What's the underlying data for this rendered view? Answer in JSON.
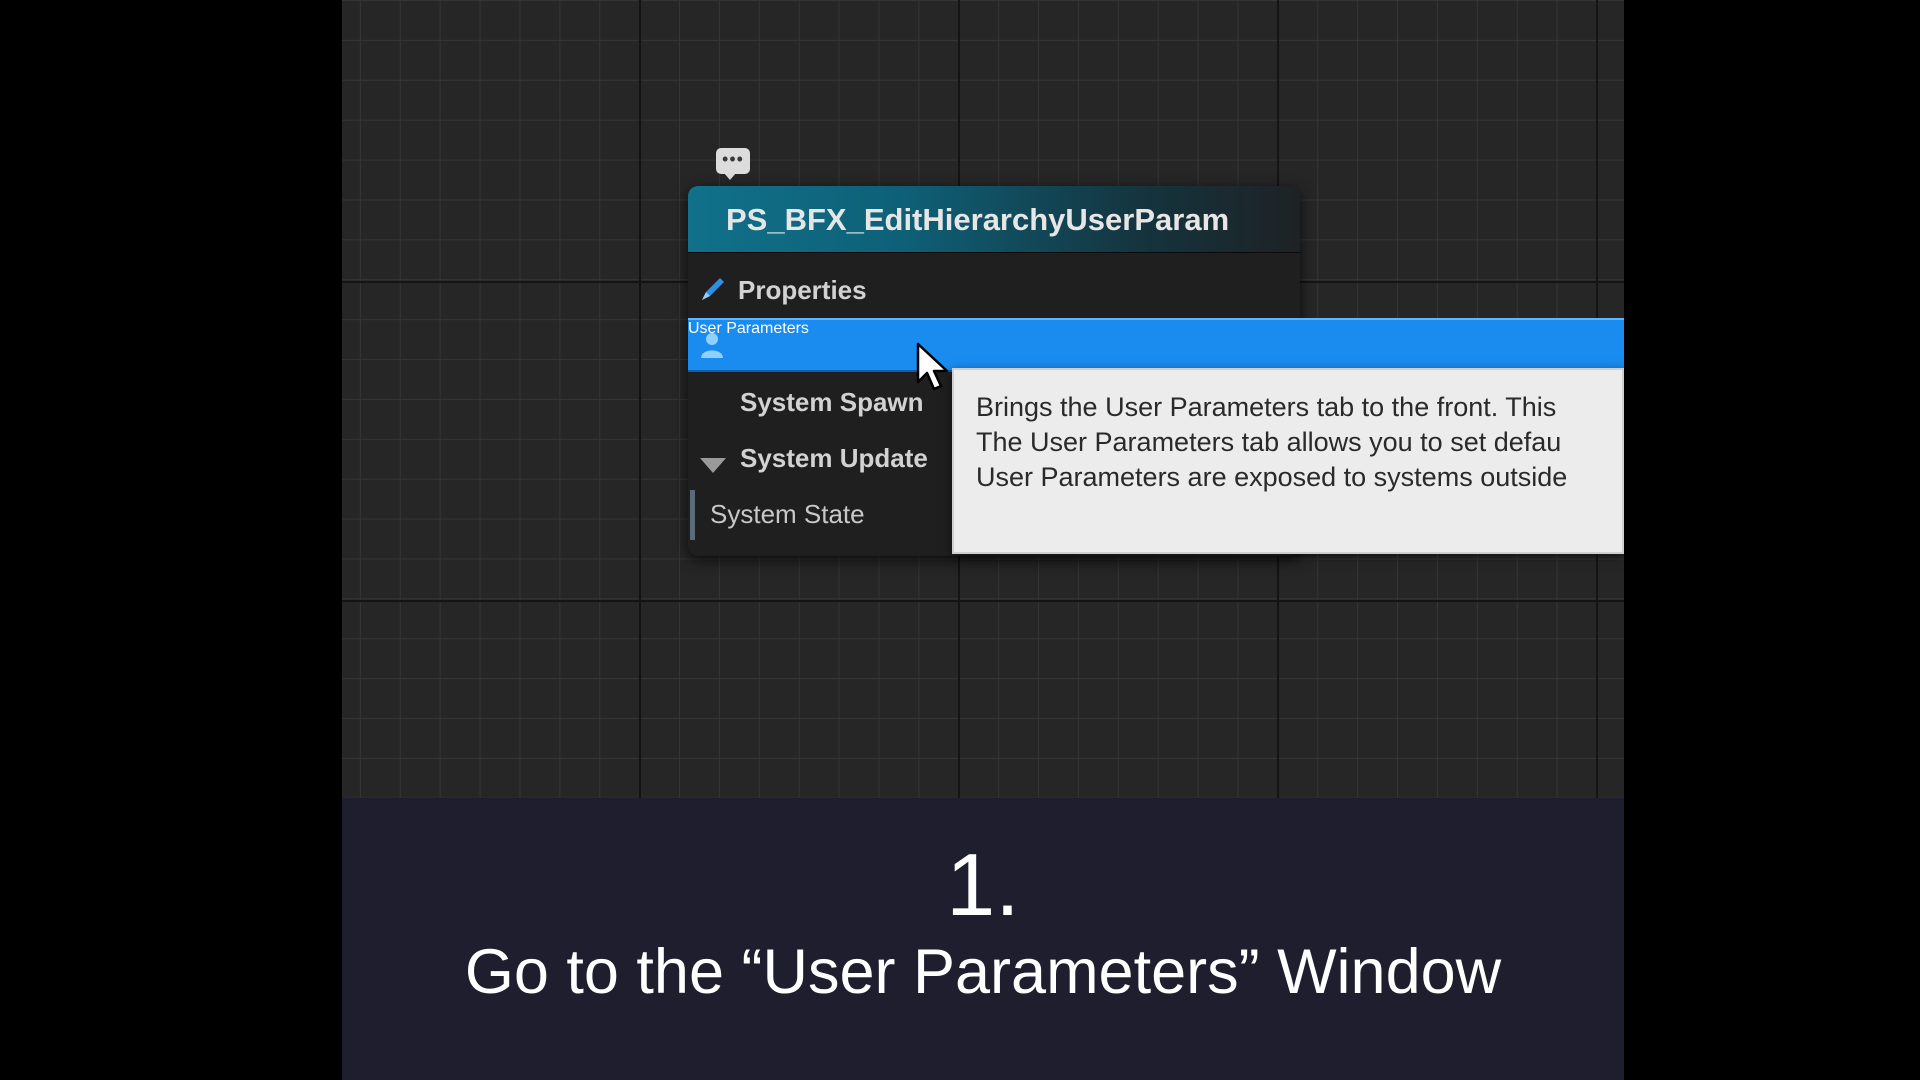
{
  "node": {
    "comment_icon": "speech-bubble-icon",
    "title": "PS_BFX_EditHierarchyUserParam",
    "rows": {
      "properties": {
        "icon": "pencil-icon",
        "label": "Properties"
      },
      "user_parameters": {
        "icon": "user-icon",
        "label": "User Parameters"
      },
      "system_spawn": {
        "label": "System Spawn"
      },
      "system_update": {
        "icon": "triangle-down-icon",
        "label": "System Update"
      },
      "system_state": {
        "label": "System State"
      }
    }
  },
  "tooltip": {
    "lines": [
      "Brings the User Parameters tab to the front. This",
      "The User Parameters tab allows you to set defau",
      "User Parameters are exposed to systems outside"
    ]
  },
  "caption": {
    "number": "1.",
    "text": "Go to the “User Parameters” Window"
  },
  "colors": {
    "header": "#10718a",
    "selected_row": "#1a8cf0",
    "caption_bg": "#1e1e2e",
    "graph_bg": "#262626"
  }
}
